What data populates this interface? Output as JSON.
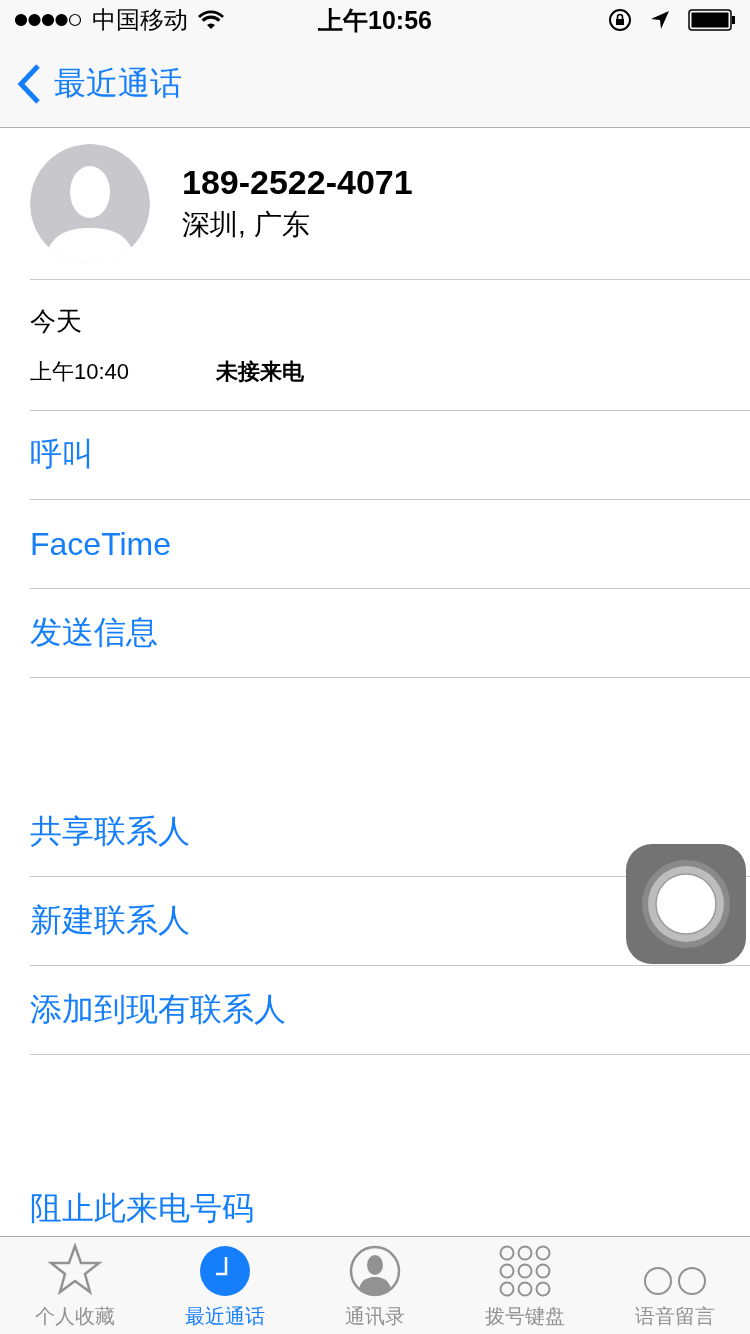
{
  "status_bar": {
    "carrier": "中国移动",
    "time": "上午10:56"
  },
  "nav": {
    "back_label": "最近通话"
  },
  "contact": {
    "number": "189-2522-4071",
    "location": "深圳, 广东"
  },
  "history": {
    "day": "今天",
    "entries": [
      {
        "time": "上午10:40",
        "type": "未接来电"
      }
    ]
  },
  "action_groups": [
    [
      "呼叫",
      "FaceTime",
      "发送信息"
    ],
    [
      "共享联系人",
      "新建联系人",
      "添加到现有联系人"
    ],
    [
      "阻止此来电号码"
    ]
  ],
  "tabs": [
    {
      "label": "个人收藏",
      "kind": "star",
      "selected": false
    },
    {
      "label": "最近通话",
      "kind": "clock",
      "selected": true
    },
    {
      "label": "通讯录",
      "kind": "contact",
      "selected": false
    },
    {
      "label": "拨号键盘",
      "kind": "keypad",
      "selected": false
    },
    {
      "label": "语音留言",
      "kind": "voicemail",
      "selected": false
    }
  ]
}
